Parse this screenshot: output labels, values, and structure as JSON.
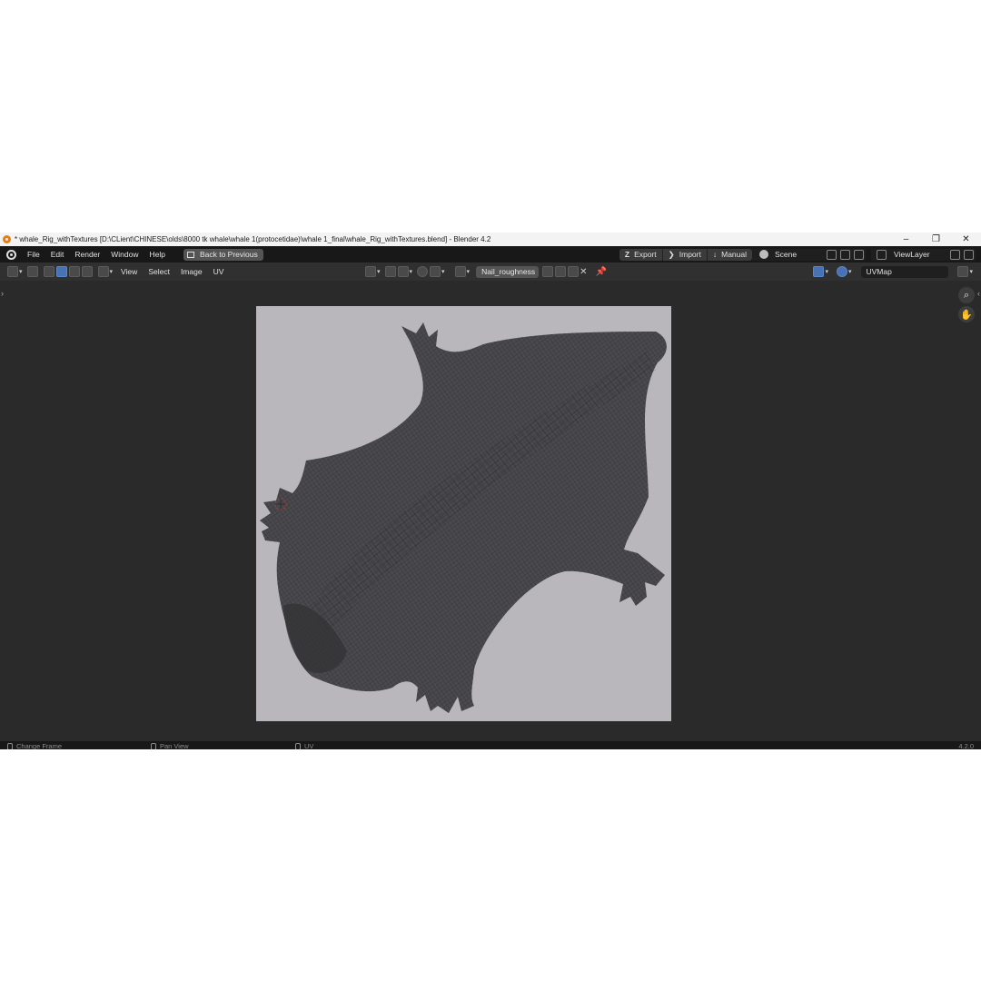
{
  "window": {
    "title": "* whale_Rig_withTextures [D:\\CLient\\CHINESE\\olds\\8000 tk whale\\whale 1(protocetidae)\\whale 1_final\\whale_Rig_withTextures.blend] - Blender 4.2",
    "minimize": "–",
    "restore": "❐",
    "close": "✕"
  },
  "topbar": {
    "menu": [
      "File",
      "Edit",
      "Render",
      "Window",
      "Help"
    ],
    "back_label": "Back to Previous",
    "export_label": "Export",
    "import_label": "Import",
    "manual_label": "Manual",
    "scene_name": "Scene",
    "view_layer": "ViewLayer"
  },
  "uv_header": {
    "menu": [
      "View",
      "Select",
      "Image",
      "UV"
    ],
    "image_name": "Nail_roughness",
    "uv_map": "UVMap"
  },
  "statusbar": {
    "change_frame": "Change Frame",
    "pan_view": "Pan View",
    "uv": "UV",
    "version": "4.2.0"
  },
  "icons": {
    "zoom": "zoom-icon",
    "hand": "hand-icon",
    "pin": "pin-icon",
    "close": "close-icon"
  },
  "colors": {
    "viewport_bg": "#2a2a2b",
    "canvas_bg": "#b9b7bc",
    "mesh": "#3a3a3d",
    "accent": "#4772b3"
  }
}
